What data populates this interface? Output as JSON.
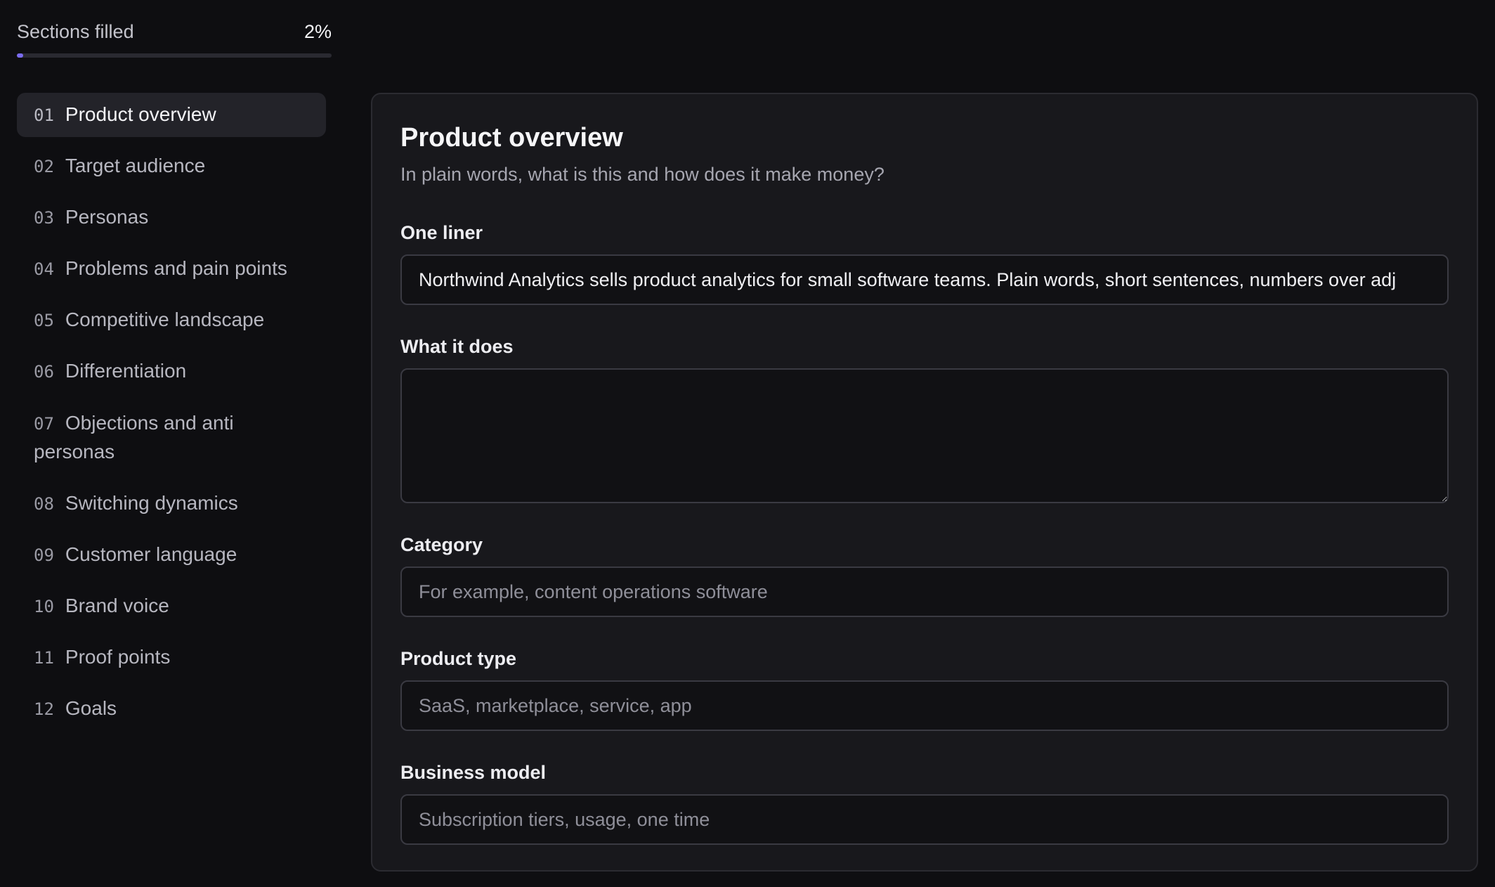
{
  "progress": {
    "label": "Sections filled",
    "value_text": "2%",
    "fraction": 0.02,
    "accent_color": "#7b6cf0"
  },
  "sidebar": {
    "items": [
      {
        "num": "01",
        "label": "Product overview",
        "active": true
      },
      {
        "num": "02",
        "label": "Target audience"
      },
      {
        "num": "03",
        "label": "Personas"
      },
      {
        "num": "04",
        "label": "Problems and pain points"
      },
      {
        "num": "05",
        "label": "Competitive landscape"
      },
      {
        "num": "06",
        "label": "Differentiation"
      },
      {
        "num": "07",
        "label": "Objections and anti personas"
      },
      {
        "num": "08",
        "label": "Switching dynamics"
      },
      {
        "num": "09",
        "label": "Customer language"
      },
      {
        "num": "10",
        "label": "Brand voice"
      },
      {
        "num": "11",
        "label": "Proof points"
      },
      {
        "num": "12",
        "label": "Goals"
      }
    ]
  },
  "main": {
    "title": "Product overview",
    "subtitle": "In plain words, what is this and how does it make money?",
    "fields": {
      "one_liner": {
        "label": "One liner",
        "value": "Northwind Analytics sells product analytics for small software teams. Plain words, short sentences, numbers over adj"
      },
      "what_it_does": {
        "label": "What it does",
        "value": ""
      },
      "category": {
        "label": "Category",
        "placeholder": "For example, content operations software"
      },
      "product_type": {
        "label": "Product type",
        "placeholder": "SaaS, marketplace, service, app"
      },
      "business_model": {
        "label": "Business model",
        "placeholder": "Subscription tiers, usage, one time"
      }
    }
  }
}
